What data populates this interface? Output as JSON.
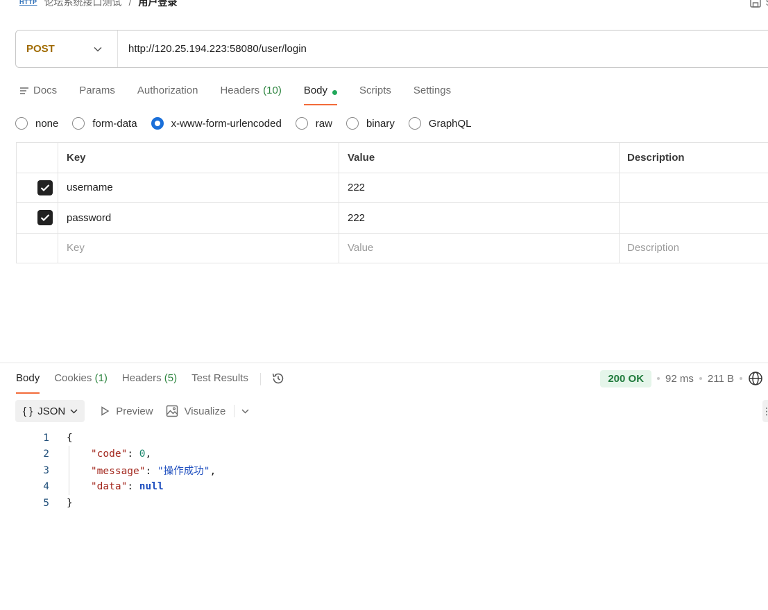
{
  "breadcrumb": {
    "badge": "HTTP",
    "parent": "论坛系统接口测试",
    "separator": "/",
    "current": "用户登录"
  },
  "header": {
    "save_label": "S"
  },
  "request": {
    "method": "POST",
    "url": "http://120.25.194.223:58080/user/login"
  },
  "request_tabs": [
    {
      "label": "Docs"
    },
    {
      "label": "Params"
    },
    {
      "label": "Authorization"
    },
    {
      "label": "Headers",
      "count": "(10)"
    },
    {
      "label": "Body",
      "active": true
    },
    {
      "label": "Scripts"
    },
    {
      "label": "Settings"
    }
  ],
  "body_types": {
    "options": [
      "none",
      "form-data",
      "x-www-form-urlencoded",
      "raw",
      "binary",
      "GraphQL"
    ],
    "selected": "x-www-form-urlencoded"
  },
  "kv_table": {
    "headers": {
      "key": "Key",
      "value": "Value",
      "description": "Description"
    },
    "rows": [
      {
        "checked": true,
        "key": "username",
        "value": "222",
        "description": ""
      },
      {
        "checked": true,
        "key": "password",
        "value": "222",
        "description": ""
      }
    ],
    "placeholder": {
      "key": "Key",
      "value": "Value",
      "description": "Description"
    }
  },
  "response_tabs": {
    "body": "Body",
    "cookies": "Cookies",
    "cookies_count": "(1)",
    "headers": "Headers",
    "headers_count": "(5)",
    "test_results": "Test Results"
  },
  "response_status": {
    "status": "200 OK",
    "time": "92 ms",
    "size": "211 B"
  },
  "response_toolbar": {
    "format": "JSON",
    "format_icon": "{ }",
    "preview": "Preview",
    "visualize": "Visualize"
  },
  "response_code": {
    "line_numbers": [
      "1",
      "2",
      "3",
      "4",
      "5"
    ],
    "open_brace": "{",
    "close_brace": "}",
    "fields": [
      {
        "key": "\"code\"",
        "value": "0",
        "trail": ","
      },
      {
        "key": "\"message\"",
        "value": "\"操作成功\"",
        "trail": ","
      },
      {
        "key": "\"data\"",
        "value": "null",
        "trail": ""
      }
    ]
  },
  "colors": {
    "accent": "#f26b3a",
    "method_post": "#a06b00",
    "status_ok_bg": "#e5f5ea",
    "status_ok_text": "#1f7a3b",
    "radio_checked": "#1a6fd9",
    "body_dot": "#22a85b"
  }
}
